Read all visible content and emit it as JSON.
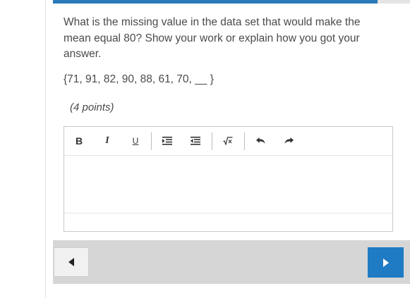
{
  "progress": {
    "fraction": 0.91,
    "color": "#2a7ab8"
  },
  "question": {
    "prompt": "What is the missing value in the data set that would make the mean equal 80? Show your work or explain how you got your answer.",
    "dataset": "{71, 91, 82, 90, 88, 61, 70, __ }",
    "points": "(4 points)"
  },
  "toolbar": {
    "bold_label": "B",
    "italic_label": "I",
    "underline_label": "U",
    "buttons": [
      "bold",
      "italic",
      "underline",
      "indent",
      "outdent",
      "equation",
      "undo",
      "redo"
    ]
  },
  "editor": {
    "value": ""
  },
  "nav": {
    "prev_icon": "triangle-left-icon",
    "next_icon": "triangle-right-icon",
    "next_color": "#1f7bc3"
  }
}
